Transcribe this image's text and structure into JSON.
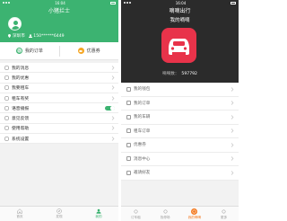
{
  "left_phone": {
    "status": {
      "time": "16:04"
    },
    "title": "小猪拦士",
    "profile": {
      "city": "深圳市",
      "phone": "150******6449"
    },
    "quick": [
      {
        "label": "我的订单"
      },
      {
        "label": "优惠券"
      }
    ],
    "menu": [
      {
        "label": "我的消息"
      },
      {
        "label": "我的优惠"
      },
      {
        "label": "我要租车"
      },
      {
        "label": "租车有奖"
      },
      {
        "label": "语音播报",
        "toggle": true
      },
      {
        "label": "意见反馈"
      },
      {
        "label": "使用帮助"
      },
      {
        "label": "系统设置"
      }
    ],
    "tabs": [
      {
        "label": "首页"
      },
      {
        "label": "发现"
      },
      {
        "label": "我的"
      }
    ]
  },
  "right_phone": {
    "status": {
      "time": "16:04"
    },
    "title": "嘀嘀出行",
    "hero": {
      "title": "我的嘀嘀",
      "count_label": "嘀嘀数：",
      "count_value": "597792"
    },
    "menu": [
      {
        "label": "我的钱包"
      },
      {
        "label": "我的订单"
      },
      {
        "label": "我的车辆"
      },
      {
        "label": "租车订单"
      },
      {
        "label": "优惠券"
      },
      {
        "label": "消息中心"
      },
      {
        "label": "邀请好友"
      }
    ],
    "tabs": [
      {
        "label": "订车租"
      },
      {
        "label": "找停场"
      },
      {
        "label": "我的嘀嘀",
        "active": true
      },
      {
        "label": "更多"
      }
    ]
  },
  "colors": {
    "green": "#3cb371",
    "dark": "#2b2b2b",
    "red": "#e8334a",
    "orange": "#f47a20",
    "coupon": "#f5a623"
  }
}
